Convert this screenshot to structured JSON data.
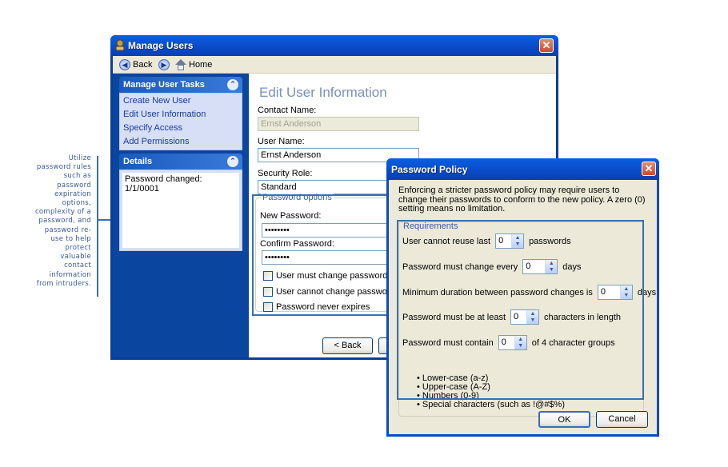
{
  "callout": {
    "text": "Utilize password rules such as password expiration options, complexity of a password, and password re-use to help protect valuable contact information from intruders."
  },
  "main_window": {
    "title": "Manage Users",
    "icons": {
      "app": "users-key-icon",
      "close": "close-icon"
    },
    "toolbar": {
      "back_label": "Back",
      "home_label": "Home"
    },
    "sidebar": {
      "tasks_header": "Manage User Tasks",
      "tasks": [
        "Create New User",
        "Edit User Information",
        "Specify Access",
        "Add Permissions"
      ],
      "details_header": "Details",
      "details_text": "Password changed: 1/1/0001"
    },
    "content": {
      "page_title": "Edit User Information",
      "contact_name_label": "Contact Name:",
      "contact_name_value": "Ernst Anderson",
      "user_name_label": "User Name:",
      "user_name_value": "Ernst Anderson",
      "security_role_label": "Security Role:",
      "security_role_value": "Standard",
      "password_options": {
        "legend": "Password options",
        "new_password_label": "New Password:",
        "new_password_value": "••••••••",
        "confirm_password_label": "Confirm Password:",
        "confirm_password_value": "••••••••",
        "checkboxes": [
          {
            "label": "User must change password at next logon",
            "checked": false
          },
          {
            "label": "User cannot change password.",
            "checked": false
          },
          {
            "label": "Password never expires",
            "checked": false
          }
        ]
      },
      "back_button": "< Back"
    }
  },
  "password_policy_dialog": {
    "title": "Password Policy",
    "description": "Enforcing a stricter password policy may require users to change their passwords to conform to the new policy. A zero (0) setting means no limitation.",
    "requirements_legend": "Requirements",
    "rules": [
      {
        "prefix": "User cannot reuse last",
        "value": "0",
        "suffix": "passwords"
      },
      {
        "prefix": "Password must change every",
        "value": "0",
        "suffix": "days"
      },
      {
        "prefix": "Minimum duration between password changes is",
        "value": "0",
        "suffix": "days"
      },
      {
        "prefix": "Password must be at least",
        "value": "0",
        "suffix": "characters in length"
      },
      {
        "prefix": "Password must contain",
        "value": "0",
        "suffix": "of 4 character groups"
      }
    ],
    "character_groups": [
      "Lower-case (a-z)",
      "Upper-case (A-Z)",
      "Numbers (0-9)",
      "Special characters (such as !@#$%)"
    ],
    "ok_button": "OK",
    "cancel_button": "Cancel"
  }
}
